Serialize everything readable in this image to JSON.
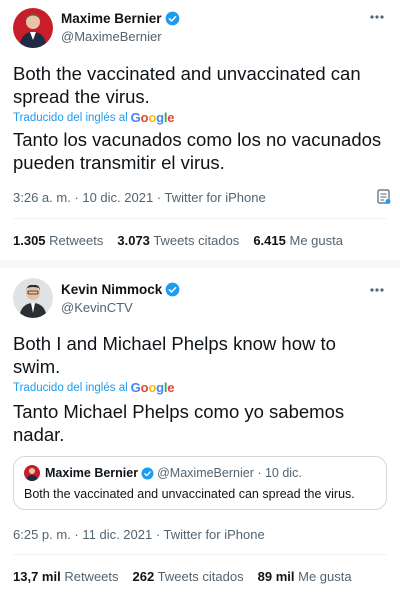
{
  "colors": {
    "accent": "#1d9bf0",
    "text": "#0f1419",
    "muted": "#536471"
  },
  "tweet1": {
    "display_name": "Maxime Bernier",
    "handle": "@MaximeBernier",
    "text_line1": "Both the vaccinated and unvaccinated can",
    "text_line2": "spread the virus.",
    "translated_label": "Traducido del inglés al",
    "translator": "Google",
    "translation_line1": "Tanto los vacunados como los no vacunados",
    "translation_line2": "pueden transmitir el virus.",
    "meta": "3:26 a. m. · 10 dic. 2021 · Twitter for iPhone",
    "retweets_count": "1.305",
    "retweets_label": "Retweets",
    "quotes_count": "3.073",
    "quotes_label": "Tweets citados",
    "likes_count": "6.415",
    "likes_label": "Me gusta"
  },
  "tweet2": {
    "display_name": "Kevin Nimmock",
    "handle": "@KevinCTV",
    "text_line1": "Both I and Michael Phelps know how to",
    "text_line2": "swim.",
    "translated_label": "Traducido del inglés al",
    "translator": "Google",
    "translation_line1": "Tanto Michael Phelps como yo sabemos",
    "translation_line2": "nadar.",
    "quoted": {
      "display_name": "Maxime Bernier",
      "handle_date": "@MaximeBernier · 10 dic.",
      "text": "Both the vaccinated and unvaccinated can spread the virus."
    },
    "meta": "6:25 p. m. · 11 dic. 2021 · Twitter for iPhone",
    "retweets_count": "13,7 mil",
    "retweets_label": "Retweets",
    "quotes_count": "262",
    "quotes_label": "Tweets citados",
    "likes_count": "89 mil",
    "likes_label": "Me gusta"
  }
}
